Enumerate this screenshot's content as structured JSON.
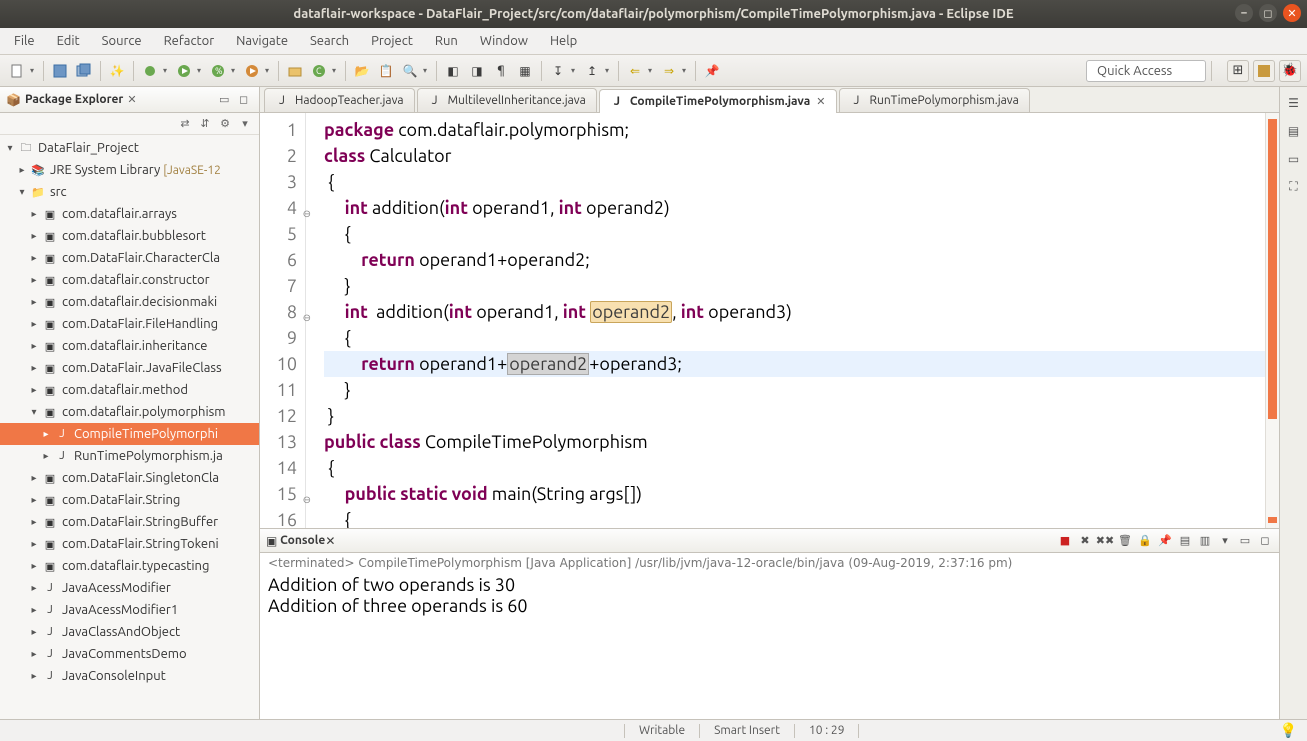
{
  "window": {
    "title": "dataflair-workspace - DataFlair_Project/src/com/dataflair/polymorphism/CompileTimePolymorphism.java - Eclipse IDE"
  },
  "menu": [
    "File",
    "Edit",
    "Source",
    "Refactor",
    "Navigate",
    "Search",
    "Project",
    "Run",
    "Window",
    "Help"
  ],
  "quick_access_placeholder": "Quick Access",
  "package_explorer": {
    "title": "Package Explorer",
    "project": "DataFlair_Project",
    "jre": "JRE System Library",
    "jre_extra": "[JavaSE-12",
    "src": "src",
    "packages": [
      "com.dataflair.arrays",
      "com.dataflair.bubblesort",
      "com.DataFlair.CharacterCla",
      "com.dataflair.constructor",
      "com.dataflair.decisionmaki",
      "com.DataFlair.FileHandling",
      "com.dataflair.inheritance",
      "com.DataFlair.JavaFileClass",
      "com.dataflair.method"
    ],
    "open_package": "com.dataflair.polymorphism",
    "open_files": [
      "CompileTimePolymorphi",
      "RunTimePolymorphism.ja"
    ],
    "packages_after": [
      "com.DataFlair.SingletonCla",
      "com.DataFlair.String",
      "com.DataFlair.StringBuffer",
      "com.DataFlair.StringTokeni",
      "com.dataflair.typecasting"
    ],
    "cu_after": [
      "JavaAcessModifier",
      "JavaAcessModifier1",
      "JavaClassAndObject",
      "JavaCommentsDemo",
      "JavaConsoleInput"
    ]
  },
  "editor_tabs": [
    {
      "label": "HadoopTeacher.java",
      "active": false
    },
    {
      "label": "MultilevelInheritance.java",
      "active": false
    },
    {
      "label": "CompileTimePolymorphism.java",
      "active": true
    },
    {
      "label": "RunTimePolymorphism.java",
      "active": false
    }
  ],
  "code": {
    "l1": {
      "kw1": "package",
      "rest": " com.dataflair.polymorphism;"
    },
    "l2": {
      "kw1": "class",
      "rest": " Calculator"
    },
    "l3": " {",
    "l4": {
      "pre": "     ",
      "kw1": "int",
      "mid": " addition(",
      "kw2": "int",
      "a": " operand1, ",
      "kw3": "int",
      "b": " operand2)"
    },
    "l5": "     {",
    "l6": {
      "pre": "         ",
      "kw": "return",
      "rest": " operand1+operand2;"
    },
    "l7": "     }",
    "l8": {
      "pre": "     ",
      "kw1": "int",
      "mid": "  addition(",
      "kw2": "int",
      "a": " operand1, ",
      "kw3": "int",
      "b": " ",
      "mark": "operand2",
      "c": ", ",
      "kw4": "int",
      "d": " operand3)"
    },
    "l9": "     {",
    "l10": {
      "pre": "         ",
      "kw": "return",
      "a": " operand1+",
      "mark": "operand2",
      "b": "+operand3;"
    },
    "l11": "     }",
    "l12": " }",
    "l13": {
      "kw1": "public",
      "kw2": "class",
      "rest": " CompileTimePolymorphism"
    },
    "l14": " {",
    "l15": {
      "pre": "     ",
      "kw1": "public",
      "kw2": "static",
      "kw3": "void",
      "rest": " main(String args[])"
    },
    "l16": "     {"
  },
  "line_numbers": [
    "1",
    "2",
    "3",
    "4",
    "5",
    "6",
    "7",
    "8",
    "9",
    "10",
    "11",
    "12",
    "13",
    "14",
    "15",
    "16"
  ],
  "console": {
    "title": "Console",
    "sub": "<terminated> CompileTimePolymorphism [Java Application] /usr/lib/jvm/java-12-oracle/bin/java (09-Aug-2019, 2:37:16 pm)",
    "lines": [
      "Addition of two operands is 30",
      "Addition of three operands is 60"
    ]
  },
  "status": {
    "writable": "Writable",
    "insert": "Smart Insert",
    "pos": "10 : 29"
  }
}
